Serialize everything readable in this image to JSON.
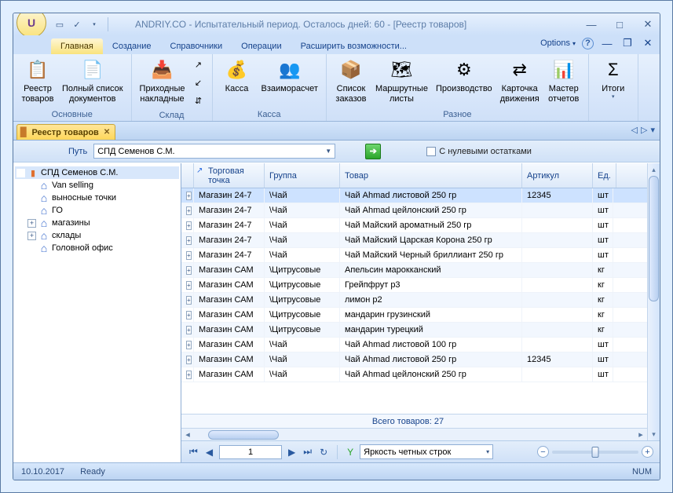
{
  "title": "ANDRIY.CO - Испытательный период. Осталось дней: 60 - [Реестр товаров]",
  "ribbon_tabs": [
    "Главная",
    "Создание",
    "Справочники",
    "Операции",
    "Расширить возможности..."
  ],
  "options_label": "Options",
  "ribbon": {
    "groups": [
      {
        "label": "Основные",
        "items": [
          {
            "t": "Реестр\nтоваров"
          },
          {
            "t": "Полный список\nдокументов"
          }
        ]
      },
      {
        "label": "Склад",
        "items": [
          {
            "t": "Приходные\nнакладные"
          }
        ]
      },
      {
        "label": "Касса",
        "items": [
          {
            "t": "Касса"
          },
          {
            "t": "Взаиморасчет"
          }
        ]
      },
      {
        "label": "Разное",
        "items": [
          {
            "t": "Список\nзаказов"
          },
          {
            "t": "Маршрутные\nлисты"
          },
          {
            "t": "Производство"
          },
          {
            "t": "Карточка\nдвижения"
          },
          {
            "t": "Мастер\nотчетов"
          }
        ]
      },
      {
        "label": "",
        "items": [
          {
            "t": "Итоги"
          }
        ]
      }
    ]
  },
  "doc_tab": "Реестр товаров",
  "path_label": "Путь",
  "path_value": "СПД Семенов С.М.",
  "zero_label": "С нулевыми остатками",
  "tree": [
    {
      "lv": 1,
      "exp": "",
      "ico": "bars",
      "t": "СПД Семенов С.М.",
      "sel": true
    },
    {
      "lv": 2,
      "exp": "",
      "ico": "house",
      "t": "Van selling"
    },
    {
      "lv": 2,
      "exp": "",
      "ico": "house",
      "t": "выносные точки"
    },
    {
      "lv": 2,
      "exp": "",
      "ico": "house",
      "t": "ГО"
    },
    {
      "lv": 2,
      "exp": "+",
      "ico": "house",
      "t": "магазины"
    },
    {
      "lv": 2,
      "exp": "+",
      "ico": "house",
      "t": "склады"
    },
    {
      "lv": 2,
      "exp": "",
      "ico": "house",
      "t": "Головной офис"
    }
  ],
  "columns": {
    "pt": "Торговая точка",
    "grp": "Группа",
    "prod": "Товар",
    "art": "Артикул",
    "unit": "Ед."
  },
  "rows": [
    {
      "pt": "Магазин 24-7",
      "grp": "\\Чай",
      "prod": "Чай Ahmad листовой 250 гр",
      "art": "12345",
      "unit": "шт",
      "sel": true
    },
    {
      "pt": "Магазин 24-7",
      "grp": "\\Чай",
      "prod": "Чай Ahmad цейлонский 250 гр",
      "art": "",
      "unit": "шт"
    },
    {
      "pt": "Магазин 24-7",
      "grp": "\\Чай",
      "prod": "Чай Майский ароматный 250 гр",
      "art": "",
      "unit": "шт"
    },
    {
      "pt": "Магазин 24-7",
      "grp": "\\Чай",
      "prod": "Чай Майский Царская Корона 250 гр",
      "art": "",
      "unit": "шт"
    },
    {
      "pt": "Магазин 24-7",
      "grp": "\\Чай",
      "prod": "Чай Майский Черный бриллиант 250 гр",
      "art": "",
      "unit": "шт"
    },
    {
      "pt": "Магазин САМ",
      "grp": "\\Цитрусовые",
      "prod": "Апельсин марокканский",
      "art": "",
      "unit": "кг"
    },
    {
      "pt": "Магазин САМ",
      "grp": "\\Цитрусовые",
      "prod": "Грейпфрут р3",
      "art": "",
      "unit": "кг"
    },
    {
      "pt": "Магазин САМ",
      "grp": "\\Цитрусовые",
      "prod": "лимон р2",
      "art": "",
      "unit": "кг"
    },
    {
      "pt": "Магазин САМ",
      "grp": "\\Цитрусовые",
      "prod": "мандарин грузинский",
      "art": "",
      "unit": "кг"
    },
    {
      "pt": "Магазин САМ",
      "grp": "\\Цитрусовые",
      "prod": "мандарин турецкий",
      "art": "",
      "unit": "кг"
    },
    {
      "pt": "Магазин САМ",
      "grp": "\\Чай",
      "prod": "Чай Ahmad листовой 100 гр",
      "art": "",
      "unit": "шт"
    },
    {
      "pt": "Магазин САМ",
      "grp": "\\Чай",
      "prod": "Чай Ahmad листовой 250 гр",
      "art": "12345",
      "unit": "шт"
    },
    {
      "pt": "Магазин САМ",
      "grp": "\\Чай",
      "prod": "Чай Ahmad цейлонский 250 гр",
      "art": "",
      "unit": "шт"
    }
  ],
  "total_label": "Всего товаров: 27",
  "page": "1",
  "brightness_label": "Яркость четных строк",
  "status": {
    "date": "10.10.2017",
    "ready": "Ready",
    "num": "NUM"
  }
}
